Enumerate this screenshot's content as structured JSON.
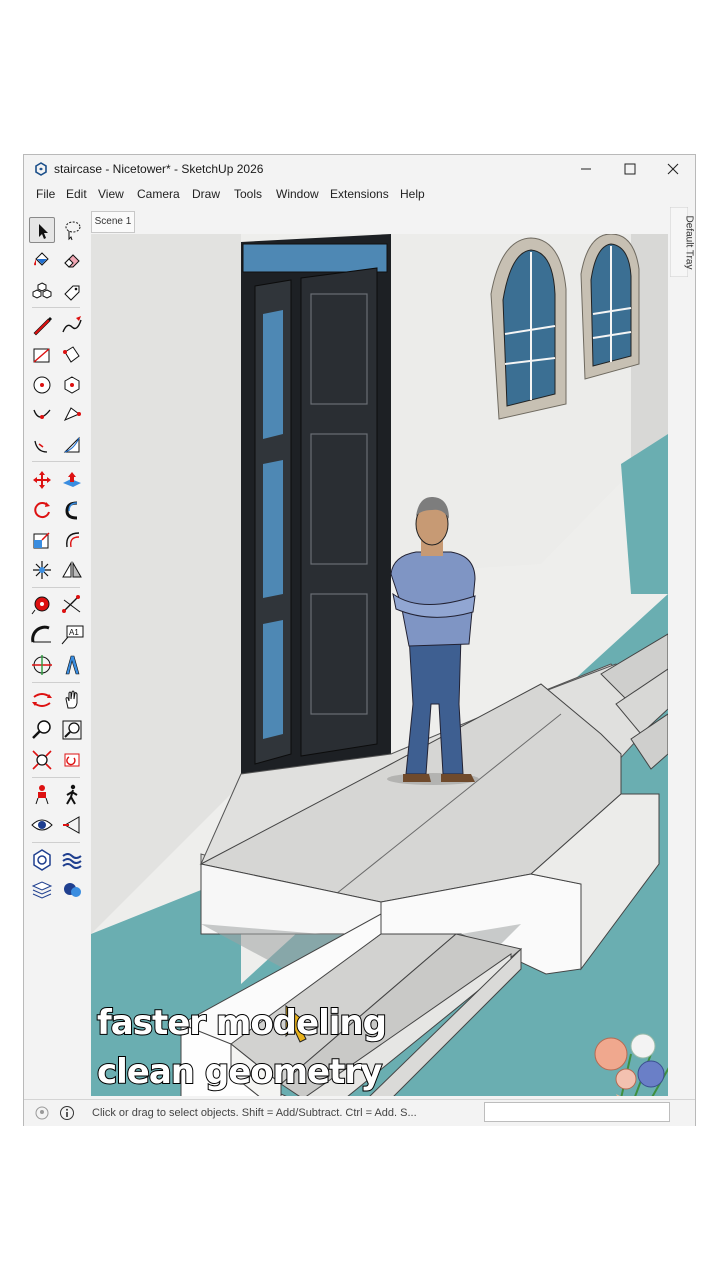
{
  "window": {
    "title": "staircase - Nicetower* - SketchUp 2026",
    "app_icon": "sketchup-logo-icon",
    "controls": [
      "minimize-icon",
      "maximize-icon",
      "close-icon"
    ]
  },
  "menu": [
    "File",
    "Edit",
    "View",
    "Camera",
    "Draw",
    "Tools",
    "Window",
    "Extensions",
    "Help"
  ],
  "scene_tab": {
    "label": "Scene 1"
  },
  "tray": {
    "label": "Default Tray"
  },
  "toolbar": {
    "tools": [
      "select-tool-icon",
      "lasso-select-icon",
      "paint-bucket-icon",
      "eraser-icon",
      "make-component-icon",
      "tag-tool-icon",
      "line-tool-icon",
      "freehand-icon",
      "rectangle-icon",
      "rotated-rectangle-icon",
      "circle-icon",
      "polygon-icon",
      "arc-icon",
      "2-point-arc-icon",
      "pie-icon",
      "3-point-arc-icon",
      "move-icon",
      "push-pull-icon",
      "rotate-icon",
      "follow-me-icon",
      "scale-icon",
      "offset-icon",
      "explode-icon",
      "flip-icon",
      "tape-measure-icon",
      "dimension-icon",
      "protractor-icon",
      "text-icon",
      "axes-icon",
      "3d-text-icon",
      "orbit-icon",
      "pan-icon",
      "zoom-icon",
      "zoom-window-icon",
      "zoom-extents-icon",
      "previous-view-icon",
      "position-camera-icon",
      "walk-icon",
      "look-around-icon",
      "section-plane-icon",
      "warehouse-icon",
      "extension-manager-icon",
      "layers-icon",
      "chat-icon"
    ]
  },
  "statusbar": {
    "text": "Click or drag to select objects. Shift = Add/Subtract. Ctrl = Add. S...",
    "icons": [
      "geolocation-icon",
      "info-icon"
    ]
  },
  "caption": {
    "line1": "faster modeling",
    "line2": "clean geometry"
  },
  "colors": {
    "ground": "#6aaeb1",
    "door": "#23272b",
    "shirt": "#7f95c4",
    "pants": "#3e5f91",
    "cursor": "#e8b21c"
  }
}
